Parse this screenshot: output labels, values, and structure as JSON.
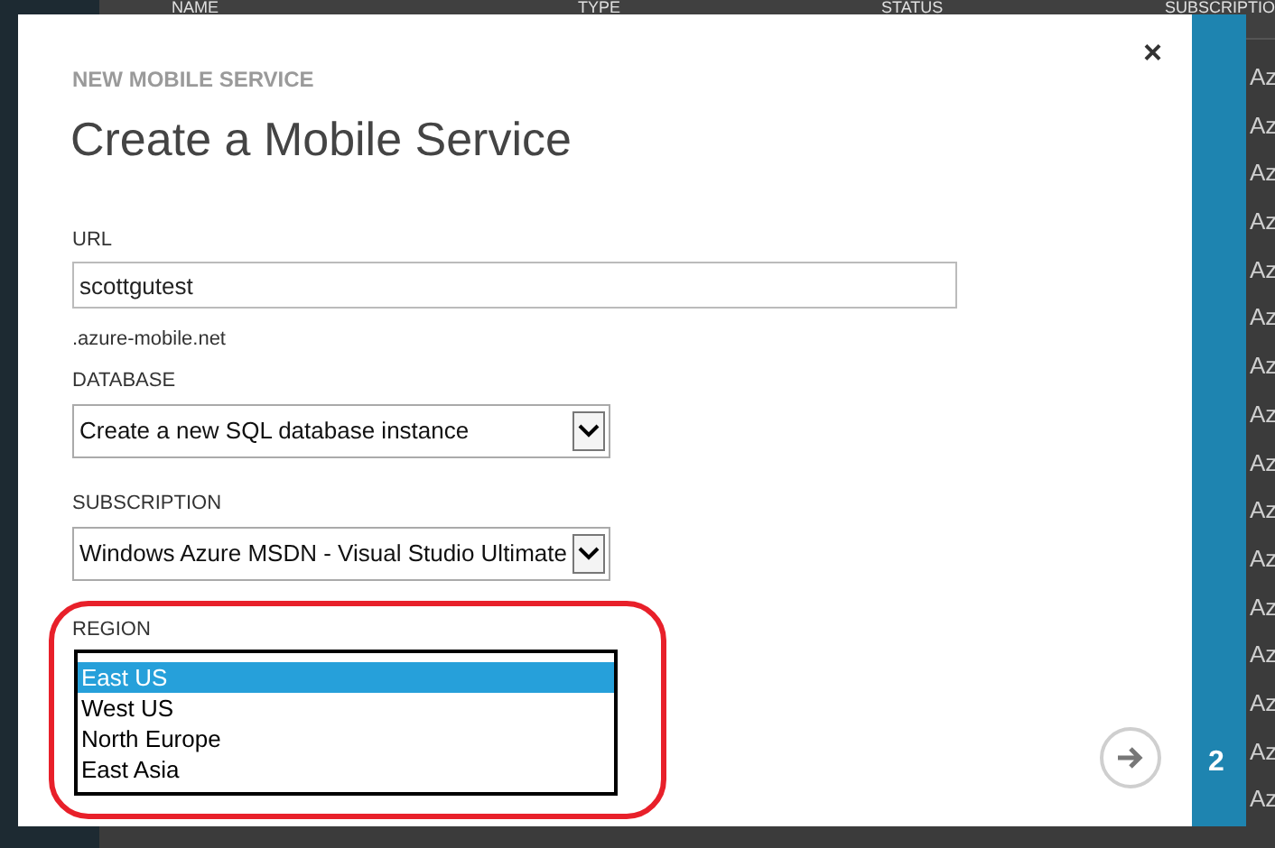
{
  "background": {
    "columns": [
      "NAME",
      "TYPE",
      "STATUS",
      "SUBSCRIPTIO"
    ],
    "rows": [
      "Az",
      "Az",
      "Az",
      "Az",
      "Az",
      "Az",
      "Az",
      "Az",
      "Az",
      "Az",
      "Az",
      "Az",
      "Az",
      "Az",
      "Az",
      "Az"
    ]
  },
  "dialog": {
    "eyebrow": "NEW MOBILE SERVICE",
    "title": "Create a Mobile Service",
    "close": "×",
    "url": {
      "label": "URL",
      "value": "scottgutest",
      "suffix": ".azure-mobile.net"
    },
    "database": {
      "label": "DATABASE",
      "value": "Create a new SQL database instance"
    },
    "subscription": {
      "label": "SUBSCRIPTION",
      "value": "Windows Azure MSDN - Visual Studio Ultimate"
    },
    "region": {
      "label": "REGION",
      "highlighted": true,
      "options": [
        {
          "label": "East US",
          "selected": true
        },
        {
          "label": "West US",
          "selected": false
        },
        {
          "label": "North Europe",
          "selected": false
        },
        {
          "label": "East Asia",
          "selected": false
        }
      ]
    },
    "step": "2"
  }
}
